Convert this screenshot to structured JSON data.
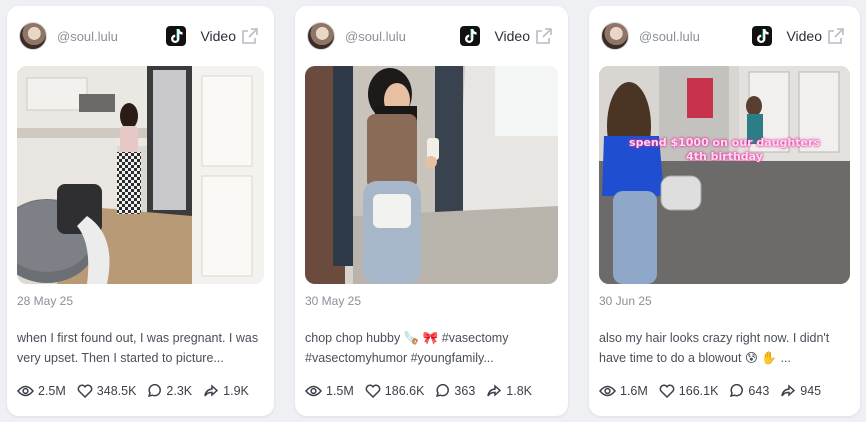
{
  "cards": [
    {
      "handle": "@soul.lulu",
      "type_label": "Video",
      "date": "28 May 25",
      "caption": "when I first found out, I was pregnant. I was very upset. Then I started to picture...",
      "overlay": "",
      "stats": {
        "views": "2.5M",
        "likes": "348.5K",
        "comments": "2.3K",
        "shares": "1.9K"
      }
    },
    {
      "handle": "@soul.lulu",
      "type_label": "Video",
      "date": "30 May 25",
      "caption": "chop chop hubby 🪚 🎀 #vasectomy #vasectomyhumor #youngfamily...",
      "overlay": "",
      "stats": {
        "views": "1.5M",
        "likes": "186.6K",
        "comments": "363",
        "shares": "1.8K"
      }
    },
    {
      "handle": "@soul.lulu",
      "type_label": "Video",
      "date": "30 Jun 25",
      "caption": "also my hair looks crazy right now. I didn't have time to do a blowout 😰 ✋ ...",
      "overlay": "spend $1000 on our daughters 4th birthday",
      "stats": {
        "views": "1.6M",
        "likes": "166.1K",
        "comments": "643",
        "shares": "945"
      }
    }
  ],
  "icons": {
    "platform": "tiktok-icon",
    "external": "external-link-icon",
    "views": "eye-icon",
    "likes": "heart-icon",
    "comments": "comment-icon",
    "shares": "share-icon"
  },
  "colors": {
    "background": "#eef0f4",
    "card": "#ffffff",
    "muted": "#8a8f99",
    "text": "#2b2f38"
  }
}
